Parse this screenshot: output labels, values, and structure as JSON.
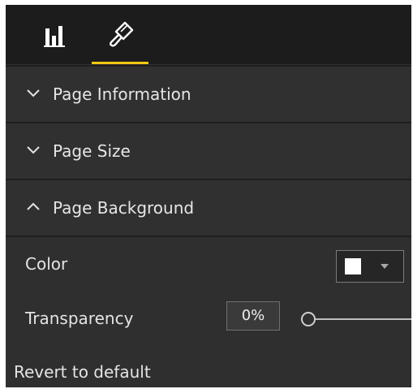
{
  "toolbar": {
    "tools": [
      {
        "name": "fields",
        "icon": "bar-chart-icon"
      },
      {
        "name": "format",
        "icon": "paint-roller-icon",
        "active": true
      }
    ],
    "accent": "#f2c811"
  },
  "sections": [
    {
      "label": "Page Information",
      "expanded": false,
      "chevron": "chevron-down-icon"
    },
    {
      "label": "Page Size",
      "expanded": false,
      "chevron": "chevron-down-icon"
    },
    {
      "label": "Page Background",
      "expanded": true,
      "chevron": "chevron-up-icon"
    }
  ],
  "background": {
    "color_label": "Color",
    "color_value": "#ffffff",
    "transparency_label": "Transparency",
    "transparency_value": "0%",
    "transparency_fraction": 0
  },
  "revert_label": "Revert to default",
  "colors": {
    "panel": "#2f2f2f",
    "toolbar": "#1c1c1c",
    "text": "#e4e4e4"
  }
}
